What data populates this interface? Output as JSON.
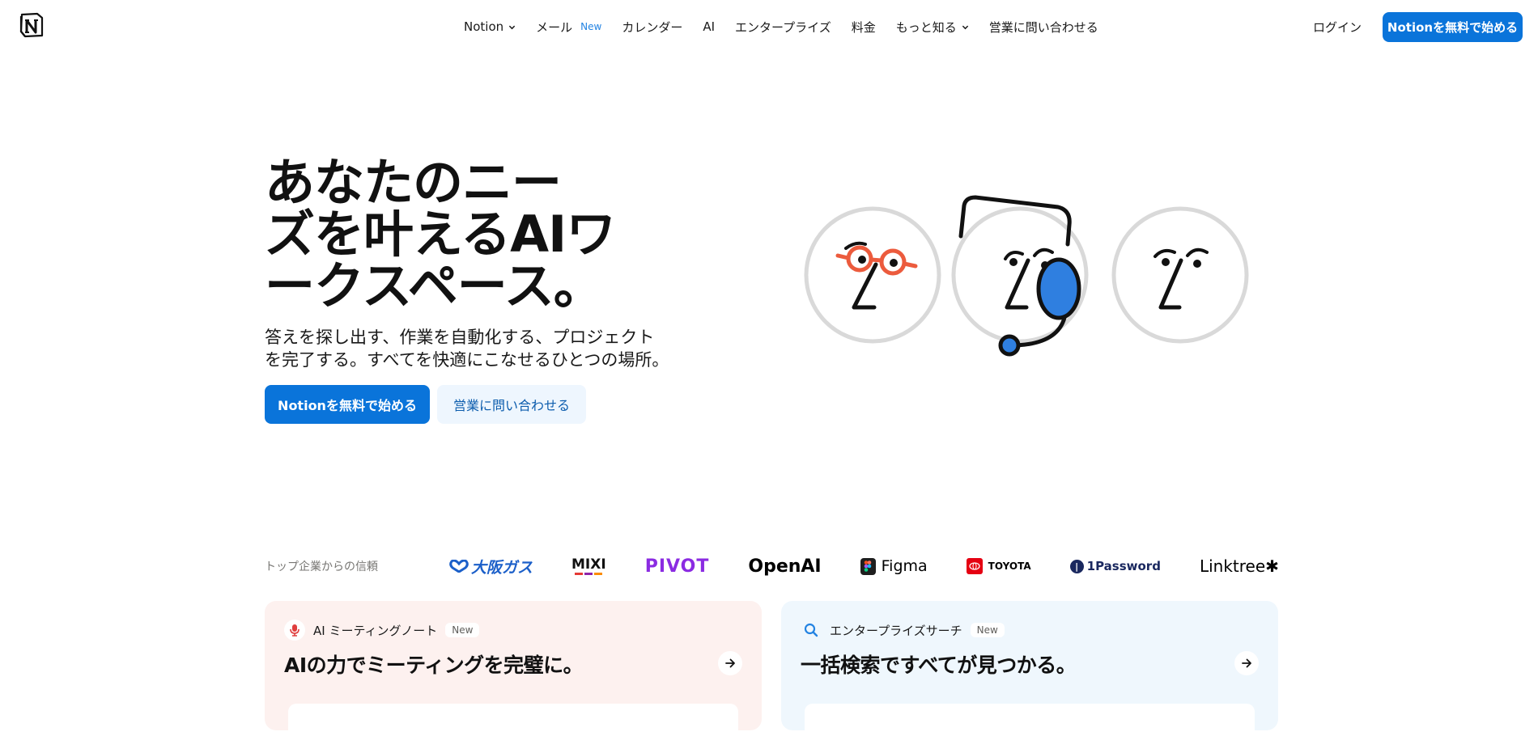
{
  "header": {
    "nav": [
      {
        "label": "Notion",
        "has_dropdown": true
      },
      {
        "label": "メール",
        "badge": "New"
      },
      {
        "label": "カレンダー"
      },
      {
        "label": "AI"
      },
      {
        "label": "エンタープライズ"
      },
      {
        "label": "料金"
      },
      {
        "label": "もっと知る",
        "has_dropdown": true
      },
      {
        "label": "営業に問い合わせる"
      }
    ],
    "login_label": "ログイン",
    "cta_label": "Notionを無料で始める"
  },
  "hero": {
    "title": "あなたのニーズを叶えるAIワークスペース。",
    "title_lines": [
      "あなたのニー",
      "ズを叶えるAIワ",
      "ークスペース。"
    ],
    "subtitle_lines": [
      "答えを探し出す、作業を自動化する、プロジェクト",
      "を完了する。すべてを快適にこなせるひとつの場所。"
    ],
    "primary_button": "Notionを無料で始める",
    "secondary_button": "営業に問い合わせる"
  },
  "trust": {
    "label": "トップ企業からの信頼",
    "logos": [
      {
        "name": "osaka-gas",
        "text": "大阪ガス"
      },
      {
        "name": "mixi",
        "text": "MIXI"
      },
      {
        "name": "pivot",
        "text": "PIVOT"
      },
      {
        "name": "openai",
        "text": "OpenAI"
      },
      {
        "name": "figma",
        "text": "Figma"
      },
      {
        "name": "toyota",
        "text": "TOYOTA"
      },
      {
        "name": "1password",
        "text": "1Password"
      },
      {
        "name": "linktree",
        "text": "Linktree✱"
      }
    ]
  },
  "cards": [
    {
      "tag": "AI ミーティングノート",
      "badge": "New",
      "title": "AIの力でミーティングを完璧に。",
      "icon": "microphone-icon",
      "accent": "#e03e3e"
    },
    {
      "tag": "エンタープライズサーチ",
      "badge": "New",
      "title": "一括検索ですべてが見つかる。",
      "icon": "search-icon",
      "accent": "#2383e2"
    }
  ],
  "colors": {
    "primary": "#0a74da",
    "secondary_bg": "#eef6fe",
    "card_left_bg": "#fdf1ef",
    "card_right_bg": "#eff7fd"
  }
}
